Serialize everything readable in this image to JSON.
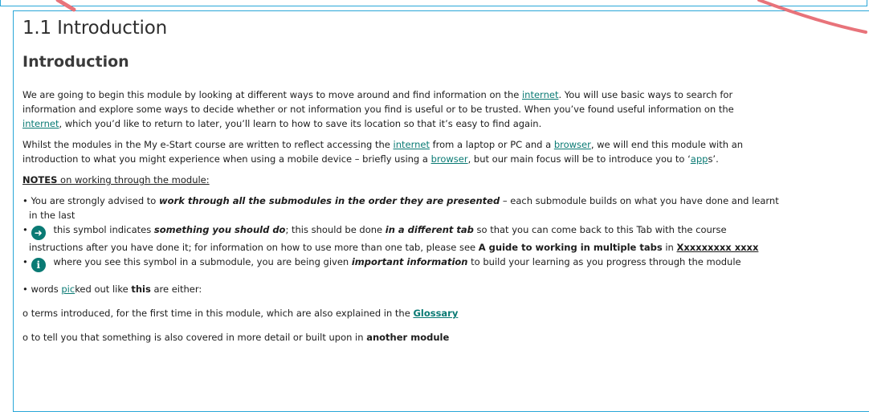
{
  "section_heading": "1.1 Introduction",
  "sub_heading": "Introduction",
  "p1": {
    "s1": "We are going to begin this module by looking at different ways to move around and find information on the ",
    "l1": "internet",
    "s2": ". You will use basic ways to search for",
    "line2": "information and explore some ways to decide whether or not information you find is useful or to be trusted. When you’ve found useful information on the",
    "l2": "internet",
    "s3": ", which you’d like to return to later, you’ll learn to how to save its location so that it’s easy to find again."
  },
  "p2": {
    "s1": "Whilst the modules in the My e-Start course are written to reflect accessing the ",
    "l1": "internet",
    "s2": " from a laptop or PC and a ",
    "l2": "browser",
    "s3": ", we will end this module with an",
    "s4": "introduction to what you might experience when using a mobile device – briefly using a ",
    "l3": "browser",
    "s5": ", but our main focus will be to introduce you to ‘",
    "l4": "app",
    "s6": "s’."
  },
  "notes": {
    "label": "NOTES",
    "rest": " on working through the module:"
  },
  "bullet1": {
    "s1": "• You are strongly advised to ",
    "em": "work through all the submodules in the order they are presented",
    "s2": " – each submodule builds on what you have done and learnt",
    "line2": "in the last"
  },
  "bullet2": {
    "dot": "•",
    "icon": "arrow-right-icon",
    "icon_glyph": "➜",
    "s1": " this symbol indicates ",
    "em1": "something you should do",
    "s2": "; this should be done ",
    "em2": "in a different tab",
    "s3": " so that you can come back to this Tab with the course",
    "s4": "instructions after you have done it; for information on how to use more than one tab, please see ",
    "b1": "A guide to working in multiple tabs",
    "s5": " in ",
    "link": "Xxxxxxxxx xxxx"
  },
  "bullet3": {
    "dot": "•",
    "icon": "info-icon",
    "icon_glyph": "i",
    "s1": " where you see this symbol in a submodule, you are being given ",
    "em": "important information",
    "s2": " to build your learning as you progress through the module"
  },
  "bullet4": {
    "s1": "• words ",
    "l1": "pic",
    "s2": "ked out like ",
    "b1": "this",
    "s3": " are either:"
  },
  "option1": {
    "s1": "o  terms introduced, for the first time in this module, which are also explained in the ",
    "link": "Glossary"
  },
  "option2": {
    "s1": "o  to tell you that something is also covered in more detail or built upon in ",
    "b1": "another module"
  },
  "colors": {
    "frame": "#2aa7d8",
    "link": "#0a7a74",
    "annotation_arrow": "#e8737a"
  }
}
